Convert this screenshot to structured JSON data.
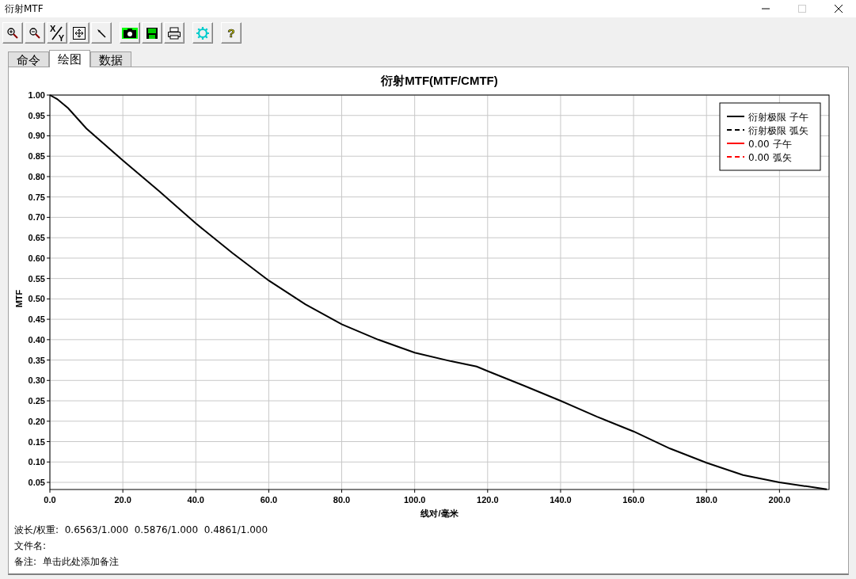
{
  "window": {
    "title": "衍射MTF"
  },
  "toolbar": [
    {
      "kind": "zoom-in"
    },
    {
      "kind": "zoom-out"
    },
    {
      "kind": "swap-axes",
      "labels": [
        "X",
        "Y"
      ]
    },
    {
      "kind": "fit"
    },
    {
      "kind": "pointer"
    },
    {
      "kind": "camera"
    },
    {
      "kind": "save"
    },
    {
      "kind": "print"
    },
    {
      "kind": "settings"
    },
    {
      "kind": "help",
      "label": "?"
    }
  ],
  "tabs": [
    {
      "label": "命令",
      "selected": false
    },
    {
      "label": "绘图",
      "selected": true
    },
    {
      "label": "数据",
      "selected": false
    }
  ],
  "plot": {
    "chart_data": {
      "type": "line",
      "title": "衍射MTF(MTF/CMTF)",
      "xlabel": "线对/毫米",
      "ylabel": "MTF",
      "x": [
        0,
        2,
        5,
        10,
        20,
        30,
        40,
        50,
        60,
        70,
        80,
        90,
        100,
        110,
        117,
        120,
        130,
        140,
        150,
        160,
        170,
        180,
        190,
        200,
        213
      ],
      "series": [
        {
          "name": "衍射极限 子午",
          "color": "#000000",
          "line_style": "solid",
          "values": [
            1.0,
            0.99,
            0.968,
            0.918,
            0.84,
            0.764,
            0.685,
            0.613,
            0.545,
            0.487,
            0.438,
            0.4,
            0.368,
            0.347,
            0.334,
            0.323,
            0.287,
            0.25,
            0.211,
            0.175,
            0.133,
            0.098,
            0.068,
            0.05,
            0.033
          ]
        },
        {
          "name": "衍射极限 弧矢",
          "color": "#000000",
          "line_style": "dashed",
          "values": [
            null,
            null,
            null,
            null,
            null,
            null,
            null,
            null,
            null,
            null,
            null,
            null,
            null,
            null,
            null,
            null,
            null,
            null,
            null,
            null,
            null,
            null,
            null,
            null,
            null
          ]
        },
        {
          "name": "0.00 子午",
          "color": "#ff0000",
          "line_style": "solid",
          "values": [
            null,
            null,
            null,
            null,
            null,
            null,
            null,
            null,
            null,
            null,
            null,
            null,
            null,
            null,
            null,
            null,
            null,
            null,
            null,
            null,
            null,
            null,
            null,
            null,
            null
          ]
        },
        {
          "name": "0.00 弧矢",
          "color": "#ff0000",
          "line_style": "dashed",
          "values": [
            null,
            null,
            null,
            null,
            null,
            null,
            null,
            null,
            null,
            null,
            null,
            null,
            null,
            null,
            null,
            null,
            null,
            null,
            null,
            null,
            null,
            null,
            null,
            null,
            null
          ]
        }
      ],
      "grid": true,
      "legend": true,
      "xlim": [
        0,
        213.6
      ],
      "ylim": [
        0.0325,
        1.0
      ],
      "xticks": [
        {
          "value": 0,
          "label": "0.0"
        },
        {
          "value": 20,
          "label": "20.0"
        },
        {
          "value": 40,
          "label": "40.0"
        },
        {
          "value": 60,
          "label": "60.0"
        },
        {
          "value": 80,
          "label": "80.0"
        },
        {
          "value": 100,
          "label": "100.0"
        },
        {
          "value": 120,
          "label": "120.0"
        },
        {
          "value": 140,
          "label": "140.0"
        },
        {
          "value": 160,
          "label": "160.0"
        },
        {
          "value": 180,
          "label": "180.0"
        },
        {
          "value": 200,
          "label": "200.0"
        }
      ],
      "yticks": [
        {
          "value": 0.05,
          "label": "0.05"
        },
        {
          "value": 0.1,
          "label": "0.10"
        },
        {
          "value": 0.15,
          "label": "0.15"
        },
        {
          "value": 0.2,
          "label": "0.20"
        },
        {
          "value": 0.25,
          "label": "0.25"
        },
        {
          "value": 0.3,
          "label": "0.30"
        },
        {
          "value": 0.35,
          "label": "0.35"
        },
        {
          "value": 0.4,
          "label": "0.40"
        },
        {
          "value": 0.45,
          "label": "0.45"
        },
        {
          "value": 0.5,
          "label": "0.50"
        },
        {
          "value": 0.55,
          "label": "0.55"
        },
        {
          "value": 0.6,
          "label": "0.60"
        },
        {
          "value": 0.65,
          "label": "0.65"
        },
        {
          "value": 0.7,
          "label": "0.70"
        },
        {
          "value": 0.75,
          "label": "0.75"
        },
        {
          "value": 0.8,
          "label": "0.80"
        },
        {
          "value": 0.85,
          "label": "0.85"
        },
        {
          "value": 0.9,
          "label": "0.90"
        },
        {
          "value": 0.95,
          "label": "0.95"
        },
        {
          "value": 1.0,
          "label": "1.00"
        }
      ]
    }
  },
  "footer": [
    "波长/权重:  0.6563/1.000  0.5876/1.000  0.4861/1.000",
    "文件名:",
    "备注:  单击此处添加备注"
  ]
}
